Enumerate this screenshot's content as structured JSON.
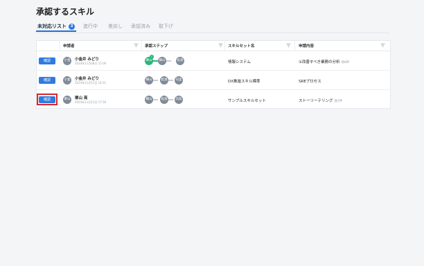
{
  "page": {
    "title": "承認するスキル"
  },
  "tabs": [
    {
      "label": "未対応リスト",
      "badge": "3",
      "active": true
    },
    {
      "label": "進行中"
    },
    {
      "label": "差戻し"
    },
    {
      "label": "承認済み"
    },
    {
      "label": "取下げ"
    }
  ],
  "table": {
    "headers": [
      "申請者",
      "承認ステップ",
      "スキルセット名",
      "申請内容"
    ],
    "confirm_label": "確認",
    "rows": [
      {
        "avatar": "小金",
        "name": "小金井 みどり",
        "date": "2024年11月08日 15:06",
        "steps": [
          {
            "label": "栗山",
            "done": true
          },
          {
            "label": "横山"
          },
          {
            "label": "松浦"
          }
        ],
        "skillset": "情報システム",
        "content": "①改善すべき業務の分析",
        "more": "他8件"
      },
      {
        "avatar": "小金",
        "name": "小金井 みどり",
        "date": "2024年11月13日 14:51",
        "steps": [
          {
            "label": "横山"
          },
          {
            "label": "松浦"
          },
          {
            "label": "向里"
          }
        ],
        "skillset": "DX推進スキル標準",
        "content": "SREプロセス",
        "more": ""
      },
      {
        "avatar": "栗山",
        "name": "栗山 亮",
        "date": "2024年11月13日 17:56",
        "steps": [
          {
            "label": "横山"
          },
          {
            "label": "松浦"
          },
          {
            "label": "向島"
          }
        ],
        "skillset": "サンプルスキルセット",
        "content": "ストーリーテリング",
        "more": "他7件"
      }
    ]
  },
  "colors": {
    "accent": "#2f7be0",
    "done": "#2db37d",
    "highlight": "#d8262a"
  }
}
